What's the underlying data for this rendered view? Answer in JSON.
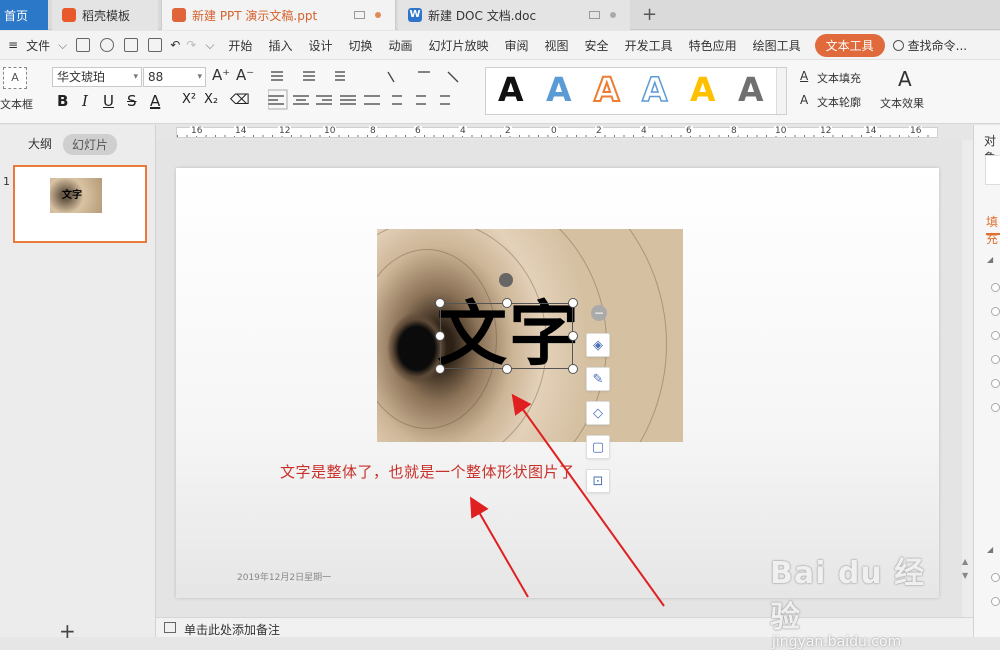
{
  "tabs": [
    {
      "label": "首页"
    },
    {
      "label": "稻壳模板"
    },
    {
      "label": "新建 PPT 演示文稿.ppt"
    },
    {
      "label": "新建 DOC 文档.doc"
    }
  ],
  "tab_new": "+",
  "menu": {
    "file": "文件",
    "items": [
      "开始",
      "插入",
      "设计",
      "切换",
      "动画",
      "幻灯片放映",
      "审阅",
      "视图",
      "安全",
      "开发工具",
      "特色应用",
      "绘图工具"
    ],
    "active": "文本工具",
    "search": "查找命令..."
  },
  "ribbon": {
    "textbox": "文本框",
    "font": "华文琥珀",
    "size": "88",
    "grow": "A⁺",
    "shrink": "A⁻",
    "bold": "B",
    "italic": "I",
    "underline": "U",
    "strike": "S",
    "color": "A",
    "sup": "X²",
    "sub": "X₂",
    "clear": "⌫",
    "wordart_letter": "A",
    "wordart_colors": [
      "#111111",
      "#5b9bd5",
      "#ed7d31",
      "#ffffff",
      "#ffc000",
      "#707070"
    ],
    "text_fill": "文本填充",
    "text_outline": "文本轮廓",
    "text_effect": "文本效果"
  },
  "leftpanel": {
    "outline": "大纲",
    "slides": "幻灯片",
    "slide_number": "1",
    "thumb_text": "文字",
    "add": "+"
  },
  "ruler": [
    "16",
    "14",
    "12",
    "10",
    "8",
    "6",
    "4",
    "2",
    "0",
    "2",
    "4",
    "6",
    "8",
    "10",
    "12",
    "14",
    "16"
  ],
  "slide": {
    "big_text": "文字",
    "caption": "文字是整体了，也就是一个整体形状图片了",
    "date": "2019年12月2日星期一"
  },
  "notes": "单击此处添加备注",
  "rightpanel": {
    "title": "对象",
    "tab": "填充"
  },
  "watermark": {
    "logo": "Bai du 经验",
    "url": "jingyan.baidu.com"
  },
  "colors": {
    "accent": "#e06a3c",
    "home_tab": "#2b77c8",
    "annotation": "#c8302a"
  }
}
